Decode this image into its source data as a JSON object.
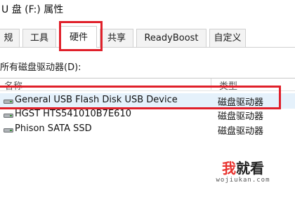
{
  "window": {
    "title": "U 盘 (F:) 属性"
  },
  "tabs": [
    {
      "label": "规",
      "active": false
    },
    {
      "label": "工具",
      "active": false
    },
    {
      "label": "硬件",
      "active": true
    },
    {
      "label": "共享",
      "active": false
    },
    {
      "label": "ReadyBoost",
      "active": false
    },
    {
      "label": "自定义",
      "active": false
    }
  ],
  "section_label": "所有磁盘驱动器(D):",
  "columns": {
    "name": "名称",
    "type": "类型"
  },
  "devices": [
    {
      "name": "General USB Flash Disk USB Device",
      "type": "磁盘驱动器",
      "selected": true,
      "icon": "disk-drive-icon"
    },
    {
      "name": "HGST HTS541010B7E610",
      "type": "磁盘驱动器",
      "selected": false,
      "icon": "disk-drive-icon"
    },
    {
      "name": "Phison SATA SSD",
      "type": "磁盘驱动器",
      "selected": false,
      "icon": "disk-drive-icon"
    }
  ],
  "annotation_color": "#e0202a",
  "selection_color": "#e5f1fb",
  "watermark": {
    "text_a": "我",
    "text_b": "就看",
    "url": "wojiukan.com"
  }
}
